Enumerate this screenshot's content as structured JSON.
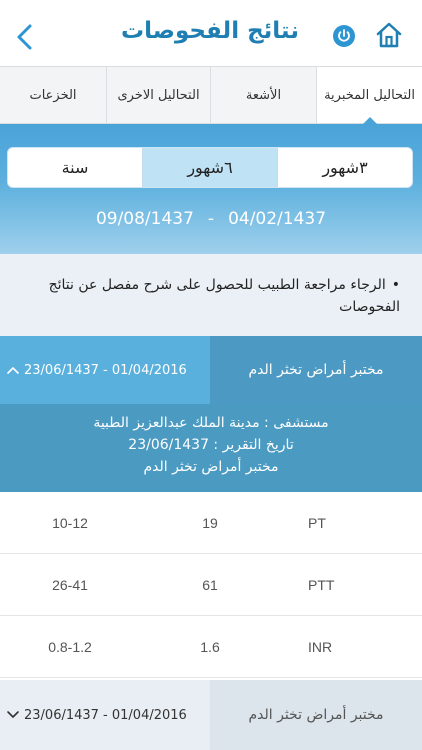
{
  "header": {
    "title": "نتائج الفحوصات",
    "back_icon": "chevron-left-icon",
    "power_icon": "power-icon",
    "home_icon": "home-icon",
    "accent": "#1f7fb3"
  },
  "tabs": [
    {
      "label": "التحاليل المخبرية",
      "active": true
    },
    {
      "label": "الأشعة",
      "active": false
    },
    {
      "label": "التحاليل الاخرى",
      "active": false
    },
    {
      "label": "الخزعات",
      "active": false
    }
  ],
  "range": {
    "options": [
      {
        "label": "٣شهور",
        "active": false
      },
      {
        "label": "٦شهور",
        "active": true
      },
      {
        "label": "سنة",
        "active": false
      }
    ],
    "date_from": "04/02/1437",
    "date_to": "09/08/1437",
    "separator": "-"
  },
  "notice": {
    "bullet": "•",
    "text": "الرجاء مراجعة الطبيب للحصول على شرح مفصل عن نتائج الفحوصات"
  },
  "groups": [
    {
      "title": "مختبر أمراض تخثر الدم",
      "date_range": "23/06/1437 - 01/04/2016",
      "expanded": true,
      "chevron_icon": "chevron-up-icon",
      "report": {
        "hospital": "مستشفى : مدينة الملك عبدالعزيز الطبية",
        "report_date": "تاريخ التقرير : 23/06/1437",
        "lab": "مختبر أمراض تخثر الدم"
      },
      "results": [
        {
          "name": "PT",
          "value": "19",
          "range": "10-12"
        },
        {
          "name": "PTT",
          "value": "61",
          "range": "26-41"
        },
        {
          "name": "INR",
          "value": "1.6",
          "range": "0.8-1.2"
        }
      ]
    },
    {
      "title": "مختبر أمراض تخثر الدم",
      "date_range": "23/06/1437 - 01/04/2016",
      "expanded": false,
      "chevron_icon": "chevron-down-icon"
    }
  ]
}
